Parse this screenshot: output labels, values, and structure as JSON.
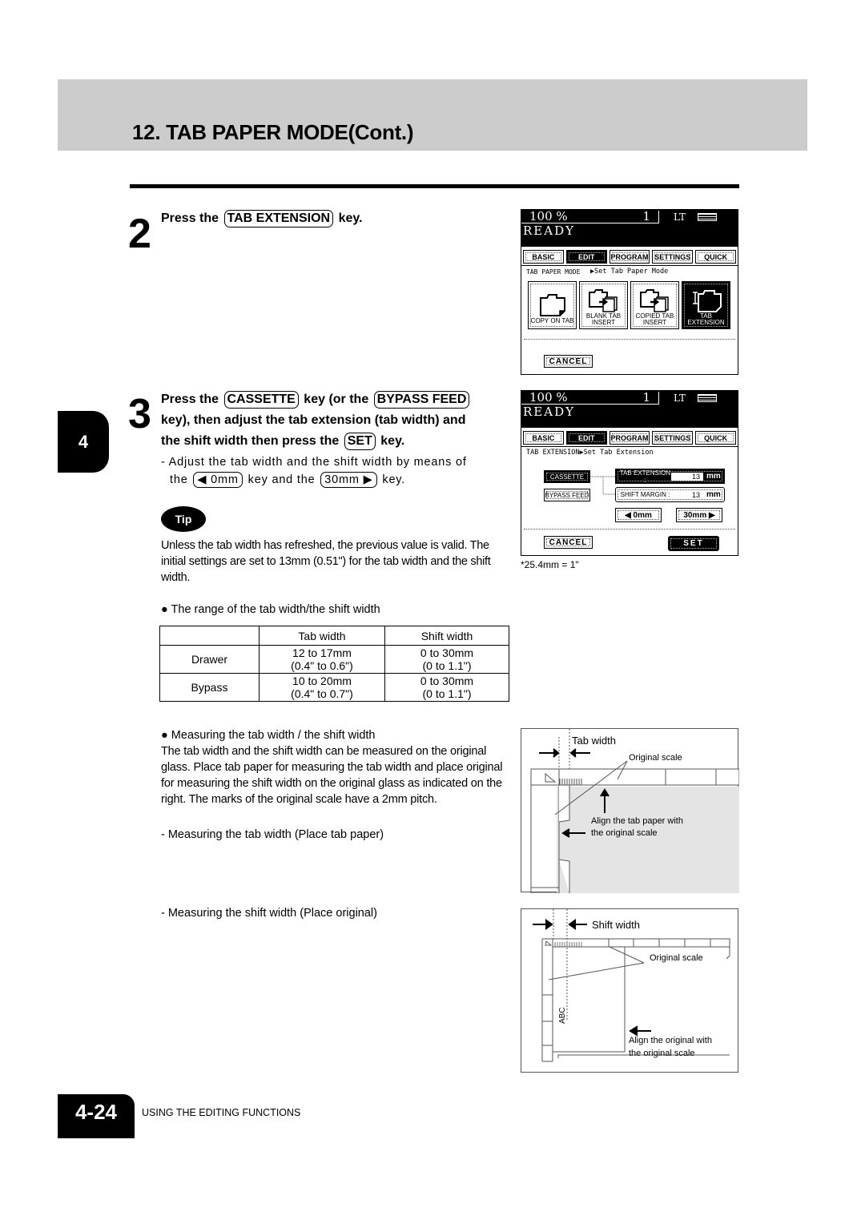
{
  "header": {
    "title": "12. TAB PAPER MODE(Cont.)"
  },
  "chapter_tab": "4",
  "step2": {
    "number": "2",
    "prefix": "Press the",
    "key": "TAB EXTENSION",
    "suffix": "key."
  },
  "step3": {
    "number": "3",
    "line1_prefix": "Press the",
    "line1_key1": "CASSETTE",
    "line1_mid": "key (or the",
    "line1_key2": "BYPASS FEED",
    "line2": "key), then adjust the tab extension (tab width) and",
    "line3_prefix": "the shift width then press the",
    "line3_key": "SET",
    "line3_suffix": "key.",
    "sub_line1": "-  Adjust the tab width and the shift width by means of",
    "sub_line2_prefix": "the",
    "sub_key1": "◀ 0mm",
    "sub_mid": "key and the",
    "sub_key2": "30mm ▶",
    "sub_suffix": "key."
  },
  "tip": {
    "badge": "Tip",
    "text": "Unless the tab width has refreshed, the previous value is valid. The initial settings are set to 13mm (0.51\") for the tab width and the shift width."
  },
  "range": {
    "bullet": "The range of the tab width/the shift width",
    "headers": [
      "",
      "Tab width",
      "Shift width"
    ],
    "rows": [
      {
        "label": "Drawer",
        "tab": [
          "12 to 17mm",
          "(0.4\" to 0.6\")"
        ],
        "shift": [
          "0 to 30mm",
          "(0 to 1.1\")"
        ]
      },
      {
        "label": "Bypass",
        "tab": [
          "10 to 20mm",
          "(0.4\" to 0.7\")"
        ],
        "shift": [
          "0 to 30mm",
          "(0 to 1.1\")"
        ]
      }
    ]
  },
  "measuring": {
    "bullet": "Measuring the tab width / the shift width",
    "text": "The tab width and the shift width can be measured on the original glass. Place tab paper for measuring the tab width and place original for measuring the shift width on the original glass as indicated on the right. The marks of the original scale have a 2mm pitch.",
    "tab_caption": "- Measuring the tab width (Place tab paper)",
    "shift_caption": "- Measuring the shift width (Place original)"
  },
  "screen1": {
    "zoom": "100  %",
    "count": "1",
    "paper": "LT",
    "status": "READY",
    "tabs": [
      "BASIC",
      "EDIT",
      "PROGRAM",
      "SETTINGS",
      "QUICK"
    ],
    "active_tab": "EDIT",
    "crumb_left": "TAB PAPER MODE",
    "crumb_right": "▶Set Tab Paper Mode",
    "modes": [
      {
        "label": "COPY ON TAB",
        "icon": "folder-tab-icon"
      },
      {
        "label": "BLANK TAB INSERT",
        "icon": "blank-insert-icon"
      },
      {
        "label": "COPIED TAB INSERT",
        "icon": "copied-insert-icon"
      },
      {
        "label": "TAB EXTENSION",
        "icon": "tab-extension-icon",
        "selected": true
      }
    ],
    "cancel": "CANCEL"
  },
  "screen2": {
    "zoom": "100  %",
    "count": "1",
    "paper": "LT",
    "status": "READY",
    "tabs": [
      "BASIC",
      "EDIT",
      "PROGRAM",
      "SETTINGS",
      "QUICK"
    ],
    "active_tab": "EDIT",
    "crumb": "TAB EXTENSION▶Set Tab Extension",
    "cassette": "CASSETTE",
    "bypass": "BYPASS FEED",
    "tab_ext_label": "TAB EXTENSION :",
    "tab_ext_value": "13",
    "shift_label": "SHIFT MARGIN :",
    "shift_value": "13",
    "unit": "mm",
    "dec_btn": "◀  0mm",
    "inc_btn": "30mm ▶",
    "cancel": "CANCEL",
    "set": "SET",
    "note": "*25.4mm = 1\""
  },
  "diagram1": {
    "tab_width": "Tab width",
    "original_scale": "Original scale",
    "align_line1": "Align the tab paper with",
    "align_line2": "the original scale"
  },
  "diagram2": {
    "shift_width": "Shift width",
    "original_scale": "Original scale",
    "align_line1": "Align the original with",
    "align_line2": "the original scale",
    "sample": "ABC"
  },
  "footer": {
    "page": "4-24",
    "section": "USING THE EDITING FUNCTIONS"
  }
}
